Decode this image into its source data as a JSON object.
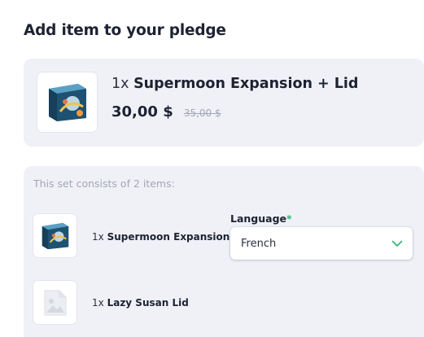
{
  "heading": "Add item to your pledge",
  "main_item": {
    "quantity": "1x",
    "name": "Supermoon Expansion + Lid",
    "price": "30,00 $",
    "original_price": "35,00 $"
  },
  "set": {
    "caption": "This set consists of 2 items:",
    "items": [
      {
        "quantity": "1x",
        "name": "Supermoon Expansion"
      },
      {
        "quantity": "1x",
        "name": "Lazy Susan Lid"
      }
    ]
  },
  "language": {
    "label": "Language",
    "required_mark": "*",
    "selected": "French"
  },
  "colors": {
    "panel_bg": "#f0f1f7",
    "required": "#2bb673",
    "chevron": "#2bb673"
  },
  "icons": {
    "placeholder": "image-placeholder-icon",
    "chevron": "chevron-down-icon"
  }
}
